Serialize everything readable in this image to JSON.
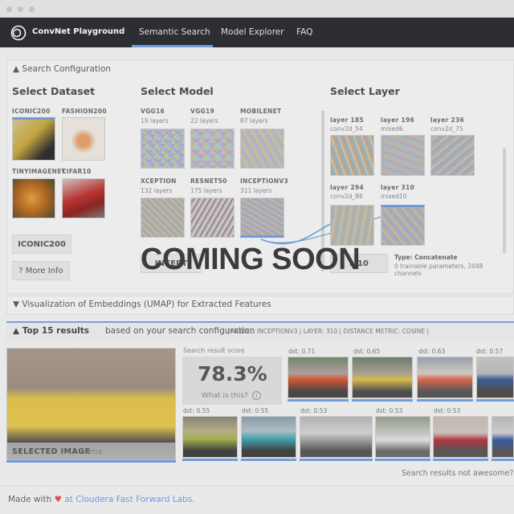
{
  "nav": {
    "brand": "ConvNet Playground",
    "tabs": [
      "Semantic Search",
      "Model Explorer",
      "FAQ"
    ],
    "active_tab": "Semantic Search"
  },
  "search_config": {
    "header": "▲ Search Configuration",
    "dataset": {
      "title": "Select Dataset",
      "options": [
        {
          "label": "ICONIC200",
          "selected": true
        },
        {
          "label": "FASHION200"
        },
        {
          "label": "TINYIMAGENET"
        },
        {
          "label": "CIFAR10"
        }
      ],
      "button": "ICONIC200",
      "more_info": "? More Info"
    },
    "model": {
      "title": "Select Model",
      "options": [
        {
          "label": "VGG16",
          "sub": "19 layers"
        },
        {
          "label": "VGG19",
          "sub": "22 layers"
        },
        {
          "label": "MOBILENET",
          "sub": "87 layers"
        },
        {
          "label": "XCEPTION",
          "sub": "132 layers"
        },
        {
          "label": "RESNET50",
          "sub": "175 layers"
        },
        {
          "label": "INCEPTIONV3",
          "sub": "311 layers",
          "selected": true
        }
      ],
      "button": "INCEPT"
    },
    "layer": {
      "title": "Select Layer",
      "options": [
        {
          "label": "layer 185",
          "sub": "conv2d_54"
        },
        {
          "label": "layer 196",
          "sub": "mixed6"
        },
        {
          "label": "layer 236",
          "sub": "conv2d_75"
        },
        {
          "label": "layer 294",
          "sub": "conv2d_86"
        },
        {
          "label": "layer 310",
          "sub": "mixed10",
          "selected": true
        }
      ],
      "button": "L    10",
      "type_label": "Type: Concatenate",
      "params": "0 trainable parameters, 2048 channels"
    }
  },
  "umap": {
    "header": "▼ Visualization of Embeddings (UMAP) for Extracted Features"
  },
  "results": {
    "title": "▲ Top 15 results",
    "title_rest": "based on your search configuration",
    "meta": "| MODEL: INCEPTIONV3 | LAYER: 310 | DISTANCE METRIC: COSINE |",
    "selected_label": "SELECTED IMAGE",
    "selected_tag": "BEETLE",
    "score_label": "Search result score",
    "score": "78.3%",
    "score_help": "What is this?",
    "row1": [
      "dst: 0.71",
      "dst: 0.65",
      "dst: 0.63",
      "dst: 0.57"
    ],
    "row2": [
      "dst: 0.55",
      "dst: 0.55",
      "dst: 0.53",
      "dst: 0.53",
      "dst: 0.53"
    ],
    "not_awesome": "Search results not awesome? H"
  },
  "overlay": {
    "text": "COMING SOON"
  },
  "footer": {
    "prefix": "Made with",
    "heart": "♥",
    "suffix": "at Cloudera Fast Forward Labs."
  }
}
